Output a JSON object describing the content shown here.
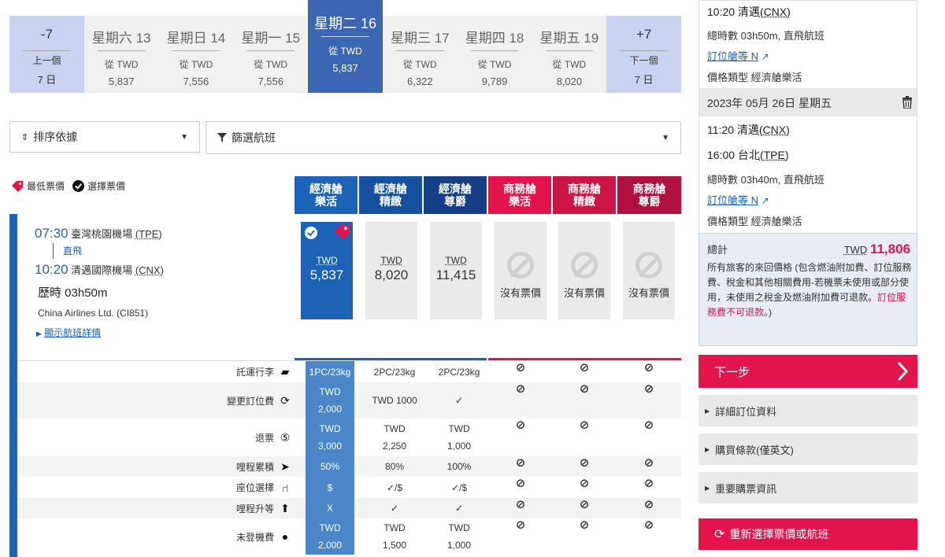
{
  "date_strip": [
    {
      "day": "-7",
      "line1": "上一個",
      "line2": "7 日",
      "type": "nav"
    },
    {
      "day": "星期六 13",
      "from": "從 TWD",
      "price": "5,837",
      "type": "date"
    },
    {
      "day": "星期日 14",
      "from": "從 TWD",
      "price": "7,556",
      "type": "date"
    },
    {
      "day": "星期一 15",
      "from": "從 TWD",
      "price": "7,556",
      "type": "date"
    },
    {
      "day": "星期二 16",
      "from": "從 TWD",
      "price": "5,837",
      "type": "active"
    },
    {
      "day": "星期三 17",
      "from": "從 TWD",
      "price": "6,322",
      "type": "date"
    },
    {
      "day": "星期四 18",
      "from": "從 TWD",
      "price": "9,789",
      "type": "date"
    },
    {
      "day": "星期五 19",
      "from": "從 TWD",
      "price": "8,020",
      "type": "date"
    },
    {
      "day": "+7",
      "line1": "下一個",
      "line2": "7 日",
      "type": "nav"
    }
  ],
  "sort": {
    "label": "排序依據"
  },
  "filter": {
    "label": "篩選航班"
  },
  "legend": {
    "lowest": "最低票價",
    "selected": "選擇票價"
  },
  "fare_headers": [
    "經濟艙\n樂活",
    "經濟艙\n精緻",
    "經濟艙\n尊爵",
    "商務艙\n樂活",
    "商務艙\n精緻",
    "商務艙\n尊爵"
  ],
  "flight": {
    "dep_time": "07:30",
    "dep_airport": "臺灣桃園機場",
    "dep_code": "(TPE)",
    "nonstop": "直飛",
    "arr_time": "10:20",
    "arr_airport": "清邁國際機場",
    "arr_code": "(CNX)",
    "duration": "歷時 03h50m",
    "airline": "China Airlines Ltd. (CI851)",
    "details_link": "顯示航班詳情"
  },
  "fares": [
    {
      "cur": "TWD",
      "amt": "5,837",
      "available": true,
      "selected": true
    },
    {
      "cur": "TWD",
      "amt": "8,020",
      "available": true,
      "selected": false
    },
    {
      "cur": "TWD",
      "amt": "11,415",
      "available": true,
      "selected": false
    },
    {
      "na": "沒有票價",
      "available": false
    },
    {
      "na": "沒有票價",
      "available": false
    },
    {
      "na": "沒有票價",
      "available": false
    }
  ],
  "rules": [
    {
      "label": "託運行李",
      "icon": "suitcase-icon",
      "eco": [
        "1PC/23kg"
      ],
      "mid": [
        [
          "2PC/23kg"
        ],
        [
          "2PC/23kg"
        ]
      ]
    },
    {
      "label": "變更訂位費",
      "icon": "refresh-icon",
      "eco": [
        "TWD",
        "2,000"
      ],
      "mid": [
        [
          "TWD 1000"
        ],
        [
          "✓"
        ]
      ]
    },
    {
      "label": "退票",
      "icon": "refund-icon",
      "eco": [
        "TWD",
        "3,000"
      ],
      "mid": [
        [
          "TWD",
          "2,250"
        ],
        [
          "TWD",
          "1,000"
        ]
      ]
    },
    {
      "label": "哩程累積",
      "icon": "plane-icon",
      "eco": [
        "50%"
      ],
      "mid": [
        [
          "80%"
        ],
        [
          "100%"
        ]
      ]
    },
    {
      "label": "座位選擇",
      "icon": "seat-icon",
      "eco": [
        "$"
      ],
      "mid": [
        [
          "✓/$"
        ],
        [
          "✓/$"
        ]
      ]
    },
    {
      "label": "哩程升等",
      "icon": "upgrade-icon",
      "eco": [
        "X"
      ],
      "mid": [
        [
          "✓"
        ],
        [
          "✓"
        ]
      ]
    },
    {
      "label": "未登機費",
      "icon": "person-icon",
      "eco": [
        "TWD",
        "2,000"
      ],
      "mid": [
        [
          "TWD",
          "1,500"
        ],
        [
          "TWD",
          "1,000"
        ]
      ]
    }
  ],
  "no_symbol": "⊘",
  "summary": {
    "seg1_arr": "10:20 清邁",
    "seg1_arr_code": "(CNX)",
    "seg1_total": "總時數 03h50m, 直飛航班",
    "seg1_link": "訂位艙等 N",
    "seg1_type": "價格類型 經濟艙樂活",
    "date2": "2023年 05月 26日 星期五",
    "seg2_dep": "11:20 清邁",
    "seg2_dep_code": "(CNX)",
    "seg2_arr": "16:00 台北",
    "seg2_arr_code": "(TPE)",
    "seg2_total": "總時數 03h40m, 直飛航班",
    "seg2_link": "訂位艙等 N",
    "seg2_type": "價格類型 經濟艙樂活",
    "total_label": "總計",
    "total_cur": "TWD",
    "total_amt": "11,806",
    "note_black": "所有旅客的來回價格 (包含燃油附加費、訂位服務費、稅金和其他相關費用-若機票未使用或部分使用，未使用之稅金及燃油附加費可退款。",
    "note_red": "訂位服務費不可退款。",
    "note_end": ")"
  },
  "next_button": "下一步",
  "accordions": [
    "詳細訂位資料",
    "購買條款(僅英文)",
    "重要購票資訊"
  ],
  "reselect_button": "重新選擇票價或航班",
  "colors": {
    "brand_blue": "#1c63b7",
    "brand_red": "#e3134b",
    "active_date": "#3a66b3"
  }
}
